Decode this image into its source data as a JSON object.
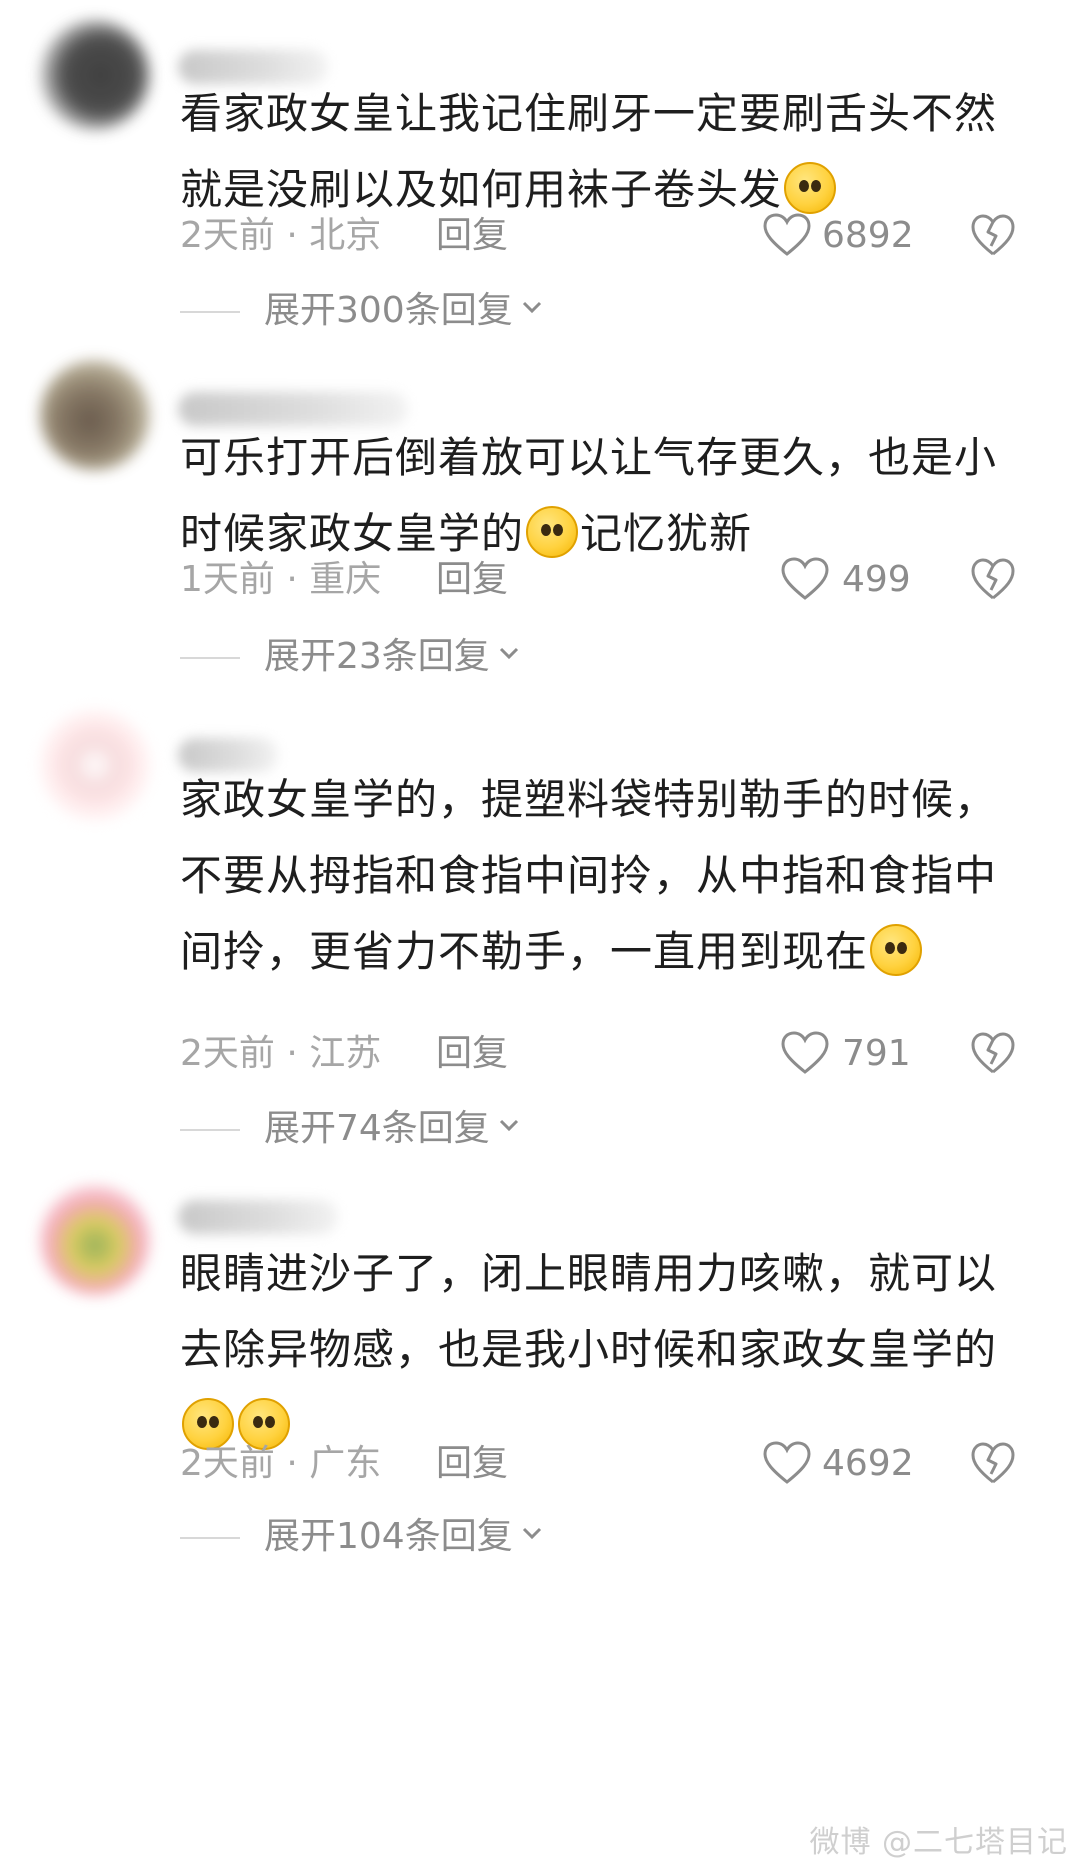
{
  "comments": [
    {
      "text": "看家政女皇让我记住刷牙一定要刷舌头不然就是没刷以及如何用袜子卷头发",
      "time_location": "2天前 · 北京",
      "reply_label": "回复",
      "likes": "6892",
      "expand_label": "展开300条回复",
      "emoji_count": 1
    },
    {
      "text": "可乐打开后倒着放可以让气存更久，也是小时候家政女皇学的",
      "text_after_emoji": "记忆犹新",
      "time_location": "1天前 · 重庆",
      "reply_label": "回复",
      "likes": "499",
      "expand_label": "展开23条回复",
      "emoji_count": 1
    },
    {
      "text": "家政女皇学的，提塑料袋特别勒手的时候，不要从拇指和食指中间拎，从中指和食指中间拎，更省力不勒手，一直用到现在",
      "time_location": "2天前 · 江苏",
      "reply_label": "回复",
      "likes": "791",
      "expand_label": "展开74条回复",
      "emoji_count": 1
    },
    {
      "text": "眼睛进沙子了，闭上眼睛用力咳嗽，就可以去除异物感，也是我小时候和家政女皇学的",
      "time_location": "2天前 · 广东",
      "reply_label": "回复",
      "likes": "4692",
      "expand_label": "展开104条回复",
      "emoji_count": 2
    }
  ],
  "watermark": "微博 @二七塔目记",
  "colors": {
    "text": "#1e1e1e",
    "meta": "#a6a6a6",
    "secondary": "#8c8c8c",
    "divider": "#d8d8d8",
    "emoji": "#ffd23f"
  },
  "icons": {
    "like": "heart-outline-icon",
    "dislike": "broken-heart-icon",
    "expand": "chevron-down-icon",
    "emoji": "emoji-face-icon"
  }
}
